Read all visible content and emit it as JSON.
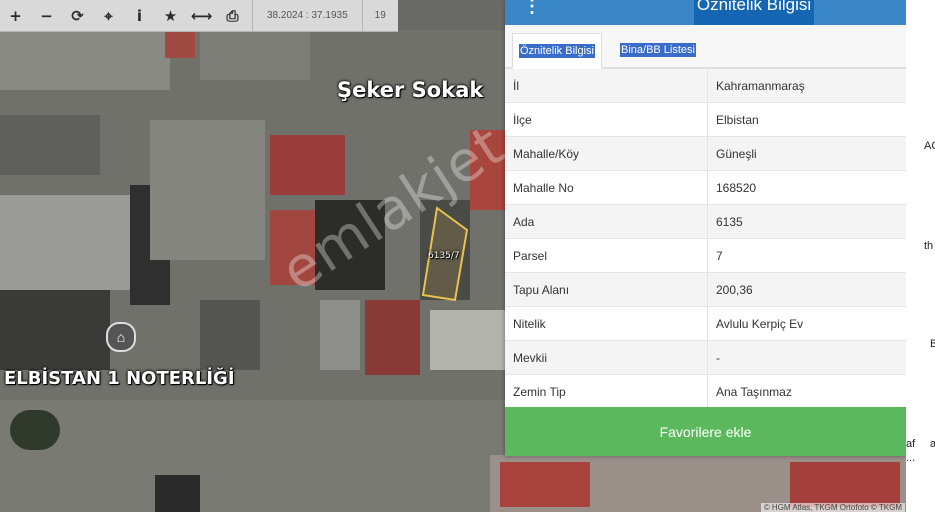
{
  "toolbar": {
    "zoom_in": "+",
    "zoom_out": "−",
    "refresh": "⟳",
    "locate": "⌖",
    "info": "i",
    "favorite": "★",
    "measure": "⟷",
    "print": "⎙",
    "coordinates": "38.2024 : 37.1935",
    "zoom_level": "19"
  },
  "map": {
    "street_label": "Şeker Sokak",
    "place_label": "ELBİSTAN 1 NOTERLİĞİ",
    "parcel_label": "6135/7",
    "watermark": "emlakjet.com",
    "attribution": "© HGM Atlas, TKGM Ortofoto © TKGM"
  },
  "panel": {
    "menu": "⋮",
    "title": "Öznitelik Bilgisi",
    "tabs": [
      "Öznitelik Bilgisi",
      "Bina/BB Listesi"
    ],
    "rows": [
      {
        "key": "İl",
        "value": "Kahramanmaraş"
      },
      {
        "key": "İlçe",
        "value": "Elbistan"
      },
      {
        "key": "Mahalle/Köy",
        "value": "Güneşli"
      },
      {
        "key": "Mahalle No",
        "value": "168520"
      },
      {
        "key": "Ada",
        "value": "6135"
      },
      {
        "key": "Parsel",
        "value": "7"
      },
      {
        "key": "Tapu Alanı",
        "value": "200,36"
      },
      {
        "key": "Nitelik",
        "value": "Avlulu Kerpiç Ev"
      },
      {
        "key": "Mevkii",
        "value": "-"
      },
      {
        "key": "Zemin Tip",
        "value": "Ana Taşınmaz"
      }
    ],
    "favorite_button": "Favorilere ekle"
  },
  "right_strip": [
    "AC",
    "th",
    "B",
    "af",
    "a",
    "..."
  ],
  "colors": {
    "header_blue": "#3a87c8",
    "title_blue": "#1466b3",
    "favorite_green": "#5cb85c",
    "tab_highlight": "#3a6cc9"
  }
}
